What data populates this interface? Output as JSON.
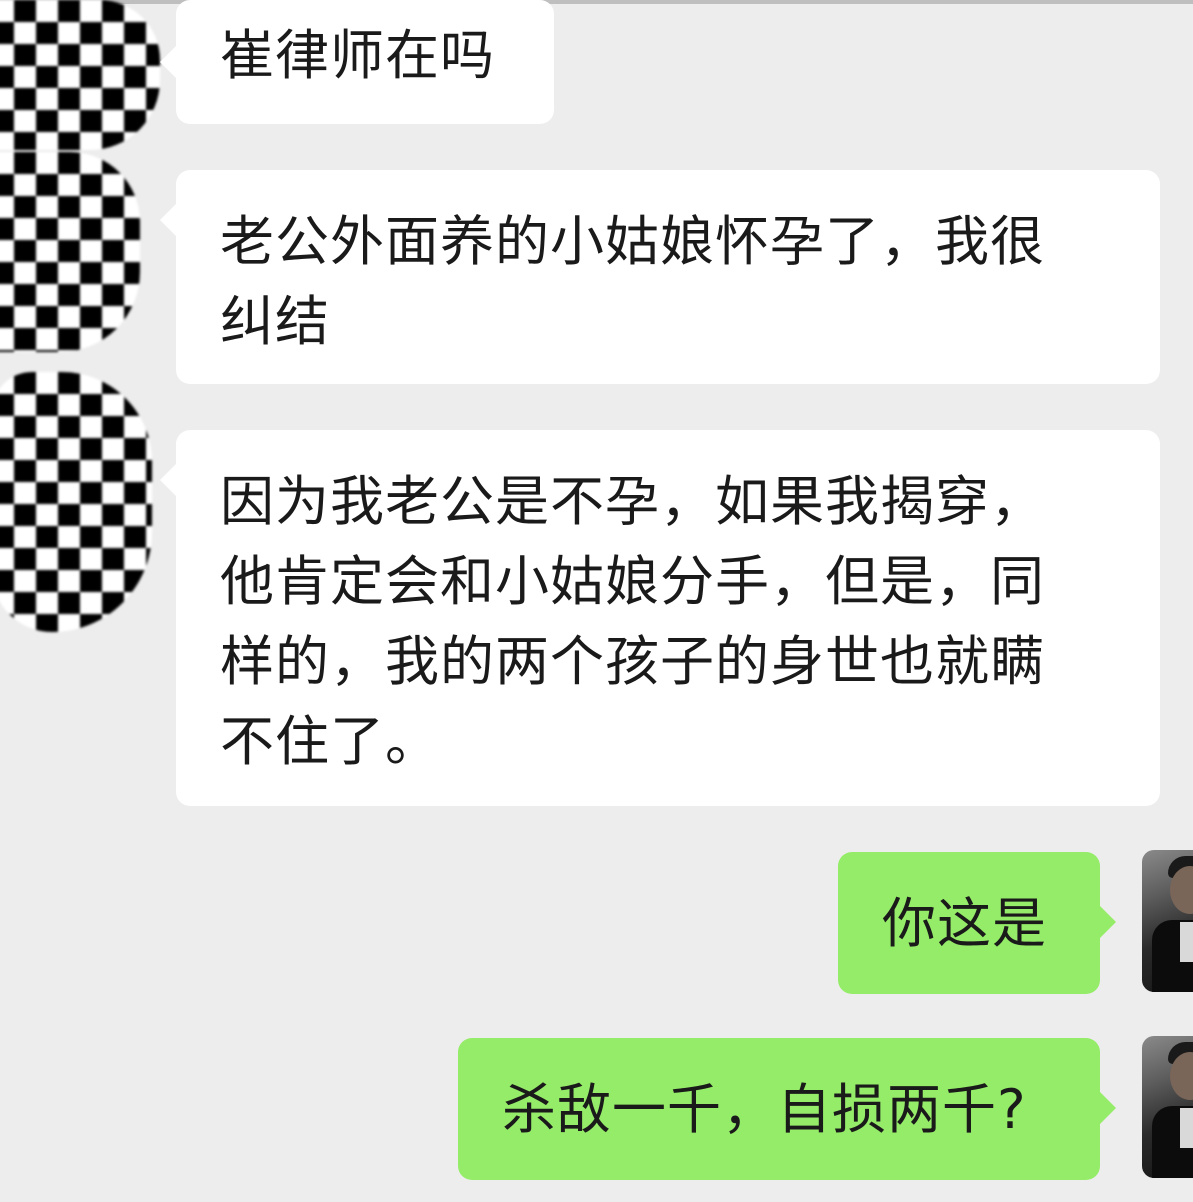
{
  "messages": [
    {
      "side": "incoming",
      "lines": [
        "崔律师在吗"
      ]
    },
    {
      "side": "incoming",
      "lines": [
        "老公外面养的小姑娘怀孕了，我很",
        "纠结"
      ]
    },
    {
      "side": "incoming",
      "lines": [
        "因为我老公是不孕，如果我揭穿，",
        "他肯定会和小姑娘分手，但是，同",
        "样的，我的两个孩子的身世也就瞒",
        "不住了。"
      ]
    },
    {
      "side": "outgoing",
      "lines": [
        "你这是"
      ]
    },
    {
      "side": "outgoing",
      "lines": [
        "杀敌一千，自损两千?"
      ]
    }
  ],
  "colors": {
    "background": "#ededed",
    "incoming_bubble": "#ffffff",
    "outgoing_bubble": "#95ec69"
  },
  "icons": {
    "contact_avatar": "mosaic-avatar",
    "self_avatar": "photo-avatar"
  }
}
